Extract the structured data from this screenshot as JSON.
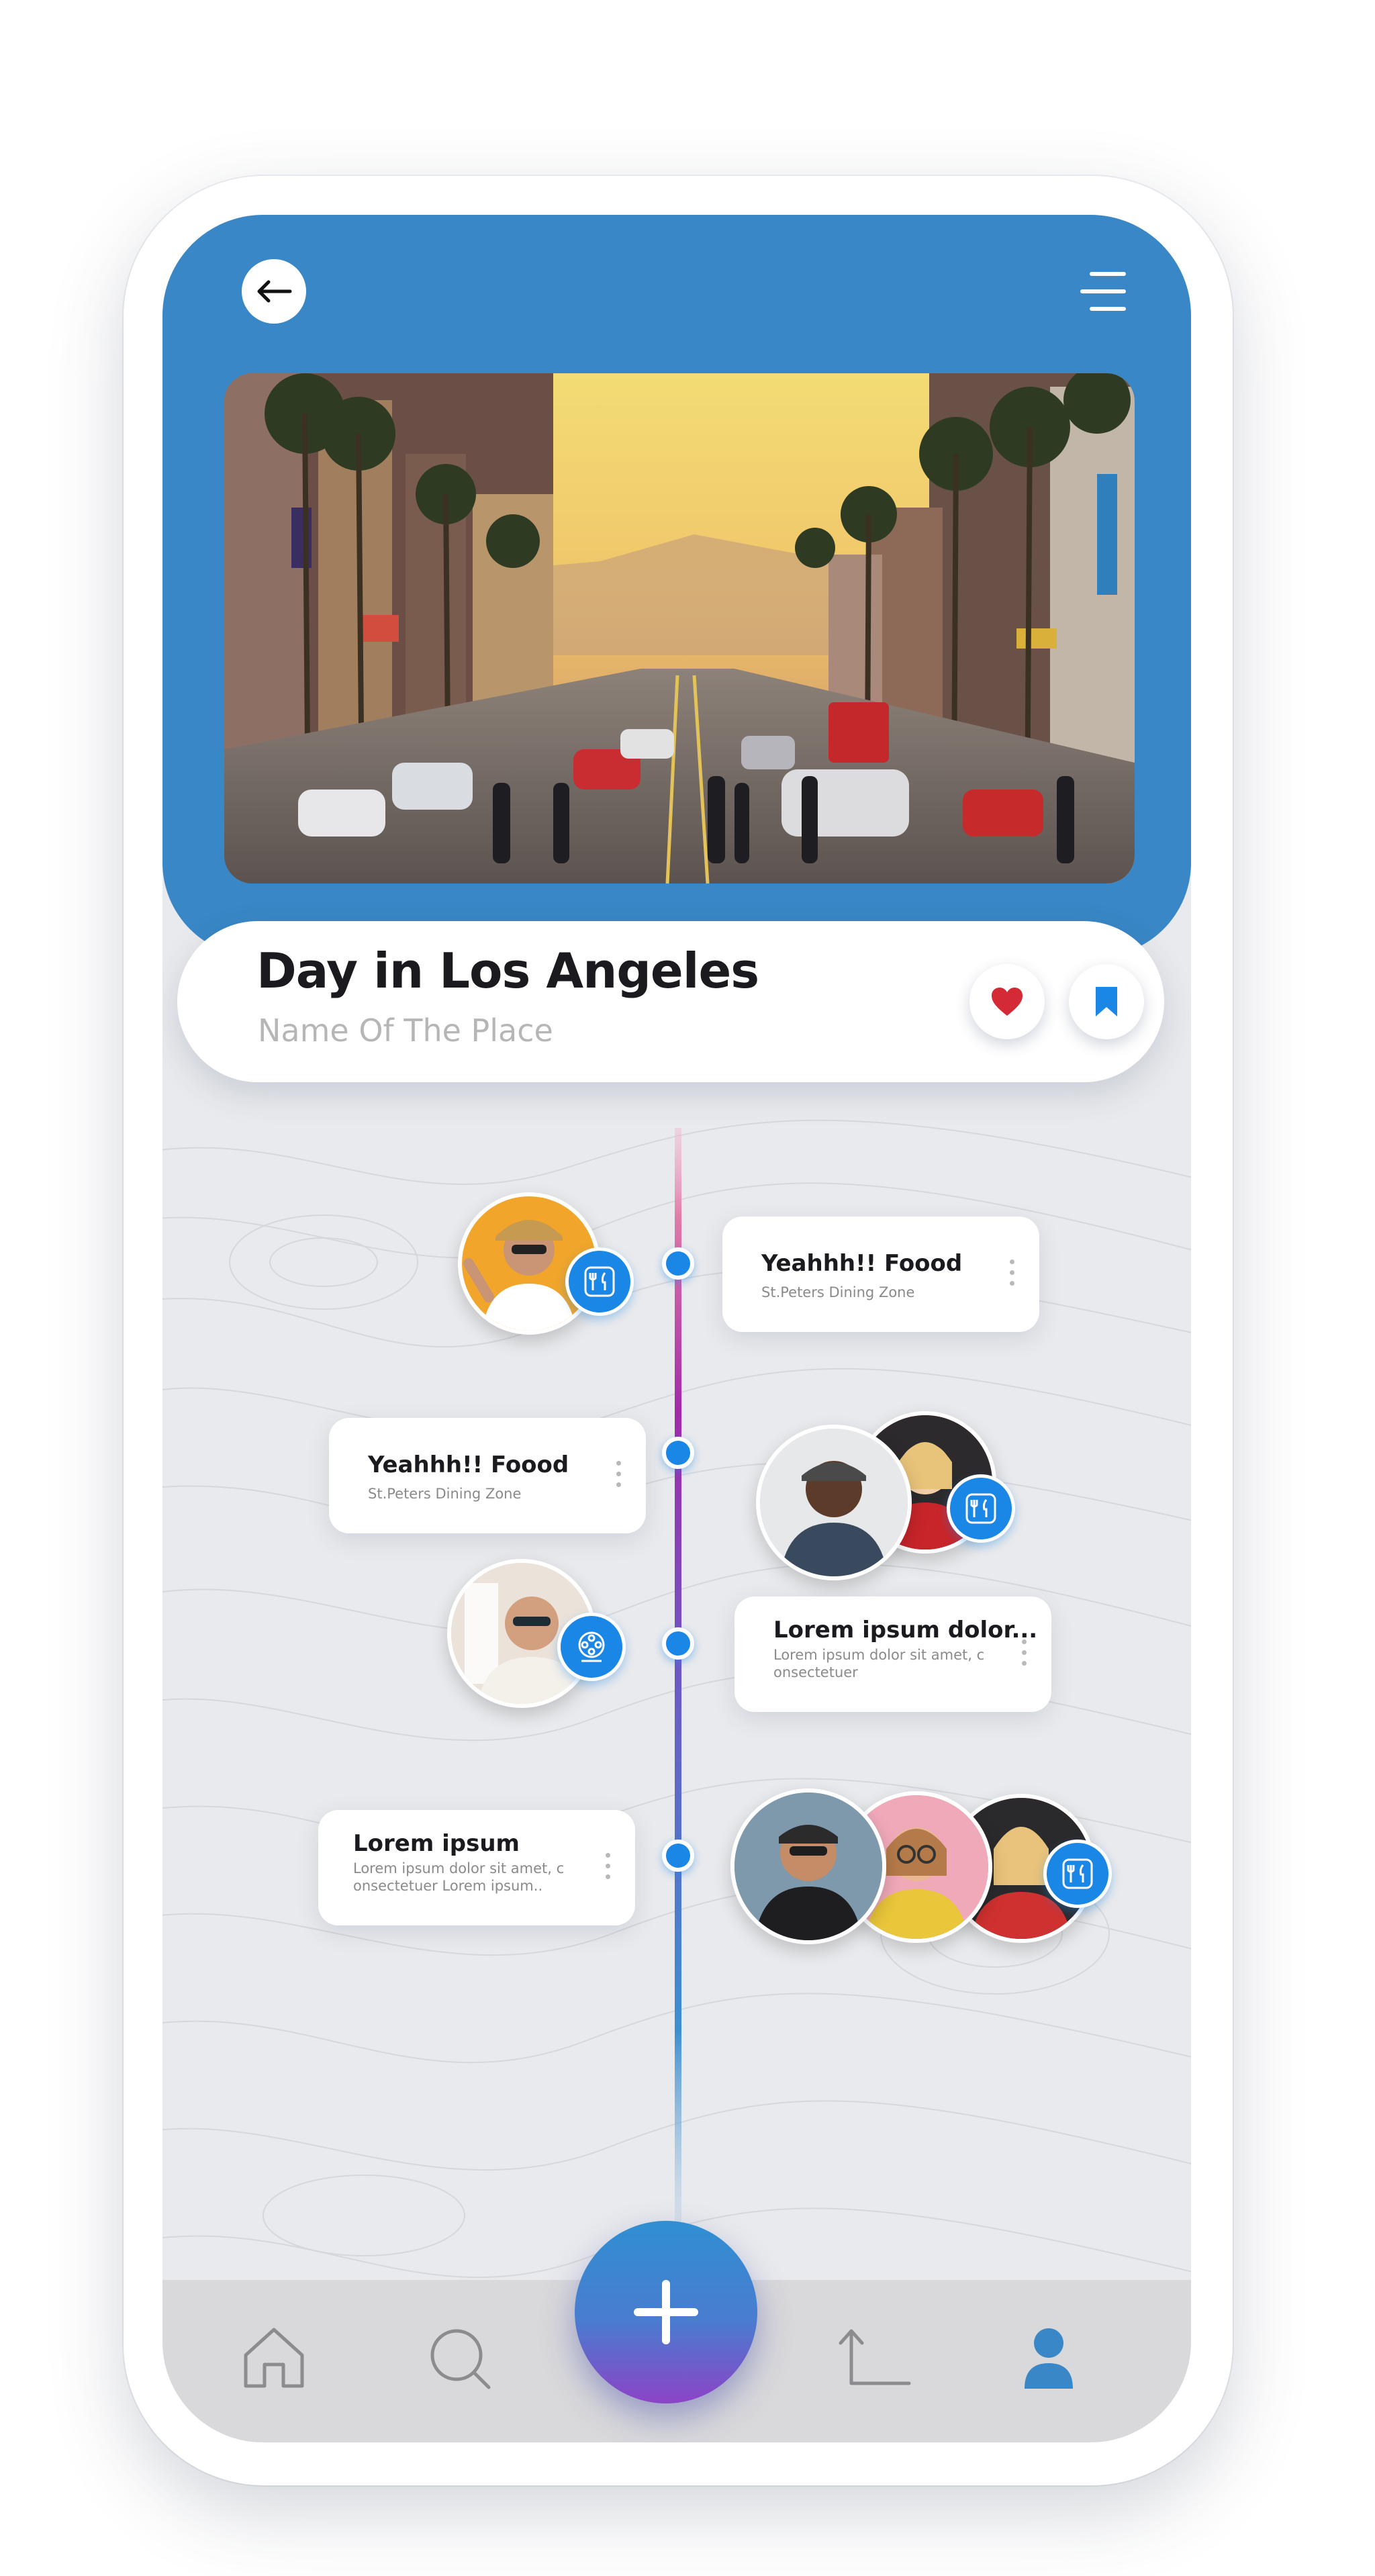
{
  "header": {
    "back_icon": "arrow-left-icon",
    "menu_icon": "menu-icon",
    "hero_image": "Hollywood Boulevard street scene at sunset with palm trees, cars and pedestrians"
  },
  "place": {
    "title": "Day in Los Angeles",
    "subtitle": "Name Of The Place",
    "like_icon": "heart-icon",
    "bookmark_icon": "bookmark-icon"
  },
  "timeline": {
    "gradient_colors": [
      "#e98fb6",
      "#a22aa8",
      "#6a4fc1",
      "#3d8fd0",
      "#c9d8e6"
    ],
    "items": [
      {
        "title": "Yeahhh!! Foood",
        "subtitle": "St.Peters Dining Zone",
        "badge_icon": "dining-icon"
      },
      {
        "title": "Yeahhh!! Foood",
        "subtitle": "St.Peters Dining Zone",
        "badge_icon": "dining-icon"
      },
      {
        "title": "Lorem ipsum dolor...",
        "subtitle": "Lorem ipsum dolor sit amet, c onsectetuer",
        "badge_icon": "film-reel-icon"
      },
      {
        "title": "Lorem ipsum",
        "subtitle": "Lorem ipsum dolor sit amet, c onsectetuer Lorem ipsum..",
        "badge_icon": "dining-icon"
      }
    ]
  },
  "nav": {
    "items": [
      {
        "icon": "home-icon",
        "active": false
      },
      {
        "icon": "search-icon",
        "active": false
      },
      {
        "icon": "plus-icon",
        "active": true
      },
      {
        "icon": "route-icon",
        "active": false
      },
      {
        "icon": "profile-icon",
        "active": true
      }
    ],
    "accent": "#3987c6"
  }
}
